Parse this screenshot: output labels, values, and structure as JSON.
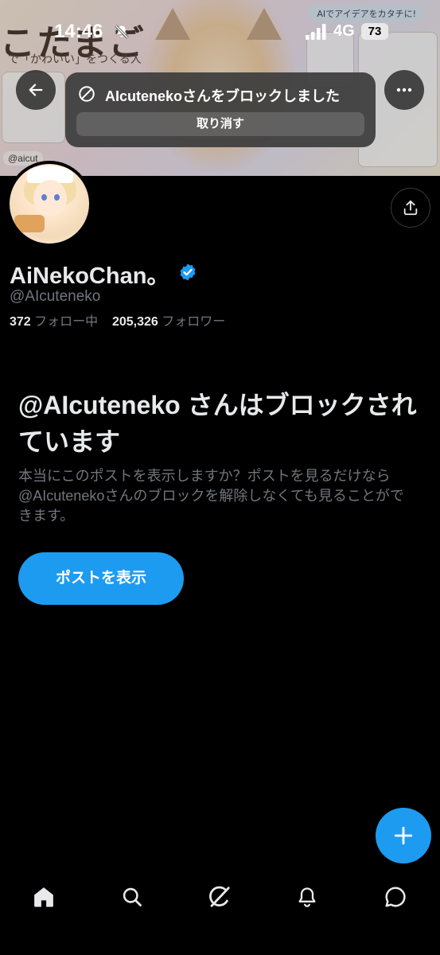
{
  "status_bar": {
    "time": "14:46",
    "network": "4G",
    "battery": "73"
  },
  "banner": {
    "art_title": "こたまご",
    "art_subtitle": "で「かわいい」をつくる人",
    "art_pill": "AIでアイデアをカタチに!",
    "art_handle": "@aicut"
  },
  "toast": {
    "message": "AIcutenekoさんをブロックしました",
    "undo_label": "取り消す"
  },
  "profile": {
    "display_name": "AiNekoChan。",
    "handle": "@AIcuteneko",
    "following_count": "372",
    "following_label": "フォロー中",
    "followers_count": "205,326",
    "followers_label": "フォロワー"
  },
  "blocked": {
    "title": "@AIcuteneko さんはブロックされています",
    "description": "本当にこのポストを表示しますか？ポストを見るだけなら@AIcutenekoさんのブロックを解除しなくても見ることができます。",
    "view_posts_label": "ポストを表示"
  },
  "colors": {
    "accent": "#1d9bf0",
    "background": "#000000",
    "text_primary": "#e7e9ea",
    "text_secondary": "#71767b"
  },
  "icons": {
    "back": "arrow-left-icon",
    "more": "more-horizontal-icon",
    "share": "share-icon",
    "verified": "verified-badge-icon",
    "fab": "plus-icon",
    "nav": [
      "home-icon",
      "search-icon",
      "grok-icon",
      "bell-icon",
      "messages-icon"
    ]
  }
}
